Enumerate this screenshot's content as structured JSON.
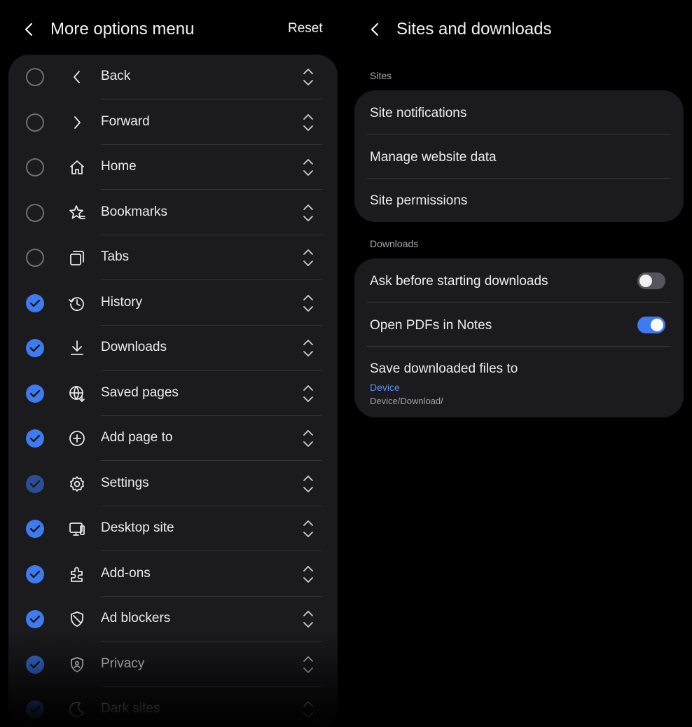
{
  "left": {
    "title": "More options menu",
    "reset_label": "Reset",
    "items": [
      {
        "label": "Back",
        "icon": "chevron-left-icon",
        "checked": false
      },
      {
        "label": "Forward",
        "icon": "chevron-right-icon",
        "checked": false
      },
      {
        "label": "Home",
        "icon": "home-icon",
        "checked": false
      },
      {
        "label": "Bookmarks",
        "icon": "star-bookmark-icon",
        "checked": false
      },
      {
        "label": "Tabs",
        "icon": "tabs-icon",
        "checked": false
      },
      {
        "label": "History",
        "icon": "history-icon",
        "checked": true
      },
      {
        "label": "Downloads",
        "icon": "download-icon",
        "checked": true
      },
      {
        "label": "Saved pages",
        "icon": "globe-download-icon",
        "checked": true
      },
      {
        "label": "Add page to",
        "icon": "plus-circle-icon",
        "checked": true
      },
      {
        "label": "Settings",
        "icon": "gear-icon",
        "checked": true
      },
      {
        "label": "Desktop site",
        "icon": "desktop-icon",
        "checked": true
      },
      {
        "label": "Add-ons",
        "icon": "puzzle-icon",
        "checked": true
      },
      {
        "label": "Ad blockers",
        "icon": "shield-icon",
        "checked": true
      },
      {
        "label": "Privacy",
        "icon": "privacy-shield-icon",
        "checked": true
      },
      {
        "label": "Dark sites",
        "icon": "moon-icon",
        "checked": true
      }
    ]
  },
  "right": {
    "title": "Sites and downloads",
    "sites_section": {
      "label": "Sites",
      "items": [
        "Site notifications",
        "Manage website data",
        "Site permissions"
      ]
    },
    "downloads_section": {
      "label": "Downloads",
      "ask_before": {
        "label": "Ask before starting downloads",
        "enabled": false
      },
      "open_pdfs": {
        "label": "Open PDFs in Notes",
        "enabled": true
      },
      "save_to": {
        "label": "Save downloaded files to",
        "value": "Device",
        "path": "Device/Download/"
      }
    }
  },
  "colors": {
    "accent": "#3e7bf1",
    "card": "#1b1b1e",
    "background": "#000000"
  }
}
